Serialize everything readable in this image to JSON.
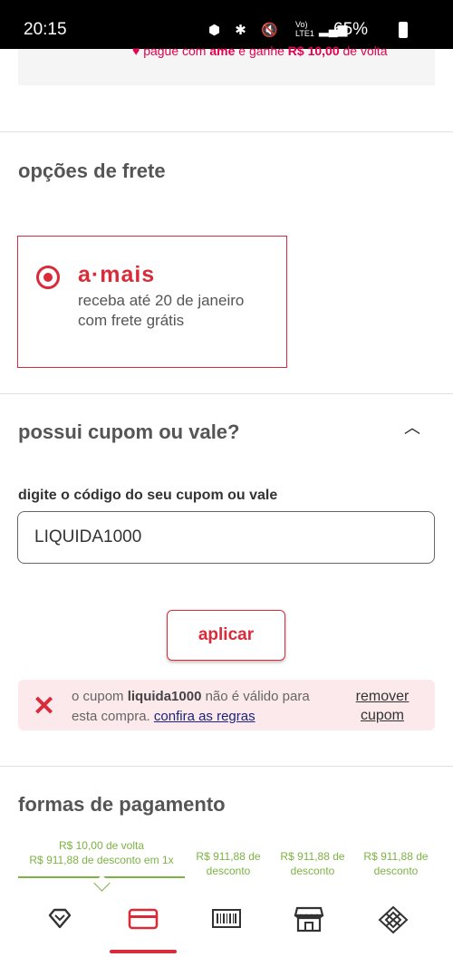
{
  "status_bar": {
    "time": "20:15",
    "icons_left": "⬢ ✱ 🔇",
    "signal": "Vo) LTE1",
    "battery": "65%"
  },
  "ame_promo": {
    "prefix": "pague com",
    "brand": "ame",
    "middle": "e ganhe",
    "amount": "R$ 10,00",
    "suffix": "de volta"
  },
  "freight": {
    "title": "opções de frete",
    "option_logo": "a·mais",
    "option_text_line1": "receba até 20 de janeiro",
    "option_text_line2": "com frete grátis"
  },
  "coupon": {
    "title": "possui cupom ou vale?",
    "field_label": "digite o código do seu cupom ou vale",
    "input_value": "LIQUIDA1000",
    "apply_label": "aplicar",
    "error": {
      "prefix": "o cupom",
      "code": "liquida1000",
      "middle": "não é válido para esta compra.",
      "rules_link": "confira as regras",
      "remove_line1": "remover",
      "remove_line2": "cupom"
    }
  },
  "payment": {
    "title": "formas de pagamento",
    "tabs": [
      {
        "line1": "R$ 10,00 de volta",
        "line2": "R$ 911,88 de desconto em 1x"
      },
      {
        "line1": "R$ 911,88 de",
        "line2": "desconto"
      },
      {
        "line1": "R$ 911,88 de",
        "line2": "desconto"
      },
      {
        "line1": "R$ 911,88 de",
        "line2": "desconto"
      }
    ]
  },
  "bottom_nav": {
    "items": [
      "ame-icon",
      "credit-card-icon",
      "barcode-icon",
      "store-icon",
      "pix-icon"
    ]
  },
  "colors": {
    "brand_red": "#d92b3a",
    "ame_pink": "#e60050",
    "discount_green": "#7cb342"
  }
}
